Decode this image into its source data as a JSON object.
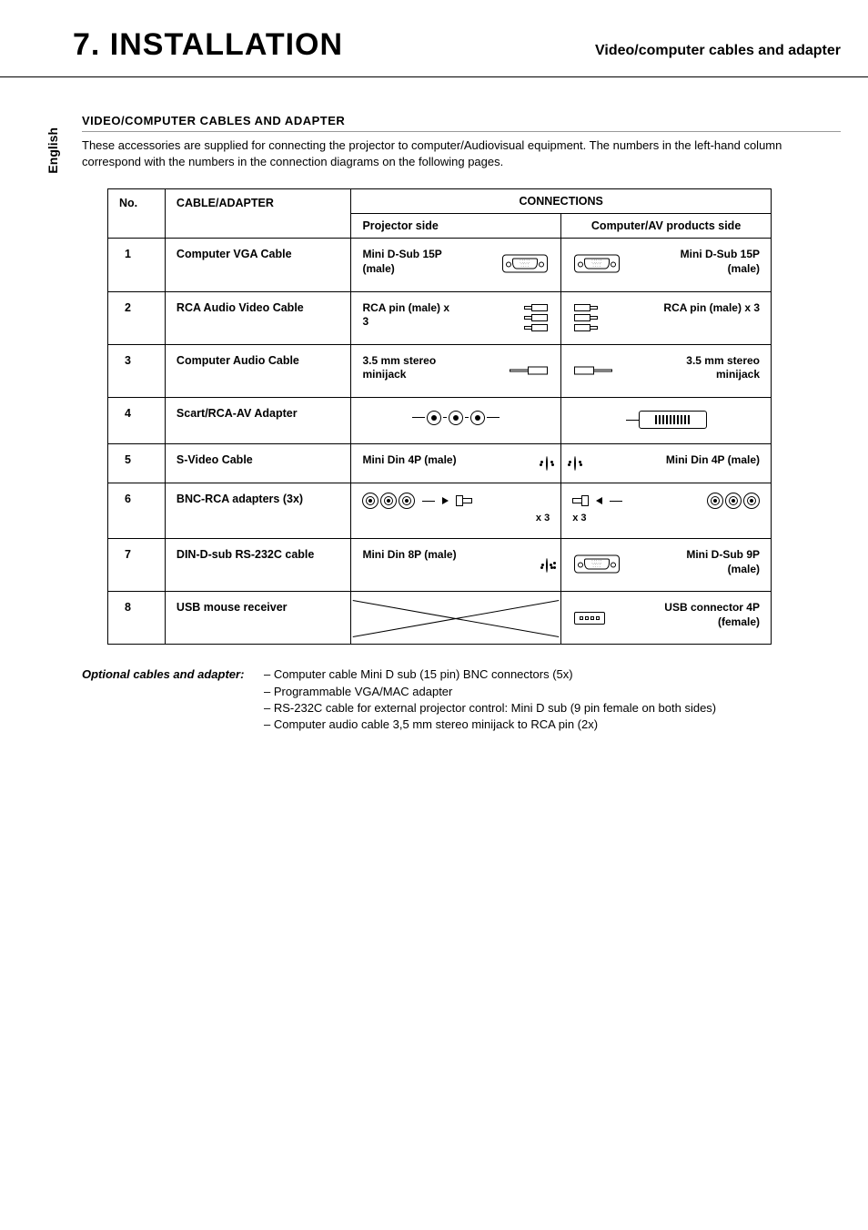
{
  "header": {
    "title": "7. INSTALLATION",
    "subtitle": "Video/computer cables and adapter"
  },
  "language": "English",
  "subheading": "VIDEO/COMPUTER CABLES AND ADAPTER",
  "intro": "These accessories are supplied for connecting the projector to computer/Audiovisual equipment. The numbers in the left-hand column correspond with the numbers in the connection diagrams on the following pages.",
  "table": {
    "head": {
      "no": "No.",
      "cable": "CABLE/ADAPTER",
      "connections": "CONNECTIONS",
      "projector": "Projector side",
      "av": "Computer/AV products side"
    },
    "rows": [
      {
        "no": "1",
        "cable": "Computer VGA Cable",
        "proj": "Mini D-Sub 15P (male)",
        "av": "Mini D-Sub 15P (male)",
        "icon": "dsub15"
      },
      {
        "no": "2",
        "cable": "RCA Audio Video Cable",
        "proj": "RCA pin (male) x 3",
        "av": "RCA pin (male) x 3",
        "icon": "rca3"
      },
      {
        "no": "3",
        "cable": "Computer Audio Cable",
        "proj": "3.5 mm stereo minijack",
        "av": "3.5 mm stereo minijack",
        "icon": "minijack"
      },
      {
        "no": "4",
        "cable": "Scart/RCA-AV Adapter",
        "proj": "",
        "av": "",
        "icon": "scart"
      },
      {
        "no": "5",
        "cable": "S-Video Cable",
        "proj": "Mini Din 4P (male)",
        "av": "Mini Din 4P (male)",
        "icon": "din4"
      },
      {
        "no": "6",
        "cable": "BNC-RCA adapters (3x)",
        "proj": "",
        "av": "",
        "icon": "bnc",
        "x3": "x 3"
      },
      {
        "no": "7",
        "cable": "DIN-D-sub RS-232C cable",
        "proj": "Mini Din 8P (male)",
        "av": "Mini D-Sub 9P (male)",
        "icon": "din8_dsub9"
      },
      {
        "no": "8",
        "cable": "USB mouse receiver",
        "proj": "",
        "av": "USB connector 4P (female)",
        "icon": "usb"
      }
    ]
  },
  "optional": {
    "label": "Optional cables and adapter:",
    "items": [
      "– Computer cable Mini D sub (15 pin) BNC connectors (5x)",
      "– Programmable VGA/MAC adapter",
      "– RS-232C cable for external projector control: Mini D sub (9 pin female on both sides)",
      "– Computer audio cable 3,5 mm stereo minijack to RCA pin (2x)"
    ]
  }
}
